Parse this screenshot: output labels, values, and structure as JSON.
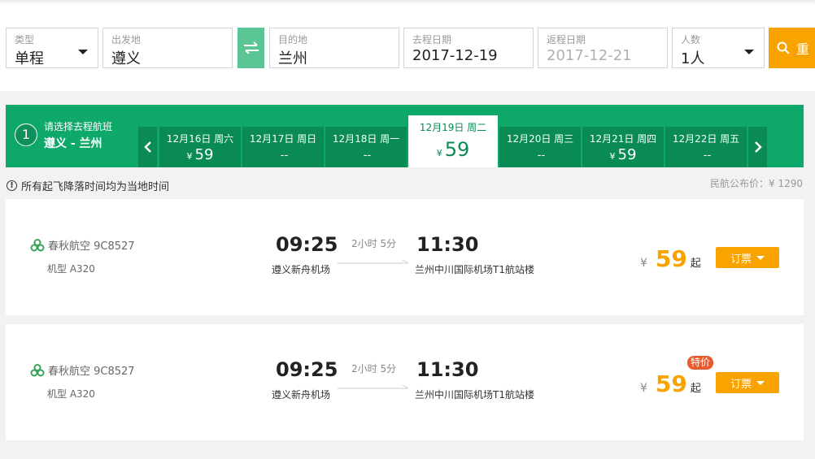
{
  "search": {
    "trip_type": {
      "label": "类型",
      "value": "单程"
    },
    "origin": {
      "label": "出发地",
      "value": "遵义"
    },
    "destination": {
      "label": "目的地",
      "value": "兰州"
    },
    "depart_date": {
      "label": "去程日期",
      "value": "2017-12-19"
    },
    "return_date": {
      "label": "返程日期",
      "value": "2017-12-21"
    },
    "passengers": {
      "label": "人数",
      "value": "1人"
    },
    "search_label": "重"
  },
  "strip": {
    "step": "1",
    "title": "请选择去程航班",
    "route": "遵义 - 兰州",
    "days": [
      {
        "date": "12月16日 周六",
        "price": "59",
        "yen": "¥"
      },
      {
        "date": "12月17日 周日",
        "price": "--",
        "yen": ""
      },
      {
        "date": "12月18日 周一",
        "price": "--",
        "yen": ""
      },
      {
        "date": "12月19日 周二",
        "price": "59",
        "yen": "¥"
      },
      {
        "date": "12月20日 周三",
        "price": "--",
        "yen": ""
      },
      {
        "date": "12月21日 周四",
        "price": "59",
        "yen": "¥"
      },
      {
        "date": "12月22日 周五",
        "price": "--",
        "yen": ""
      }
    ]
  },
  "notice": "所有起飞降落时间均为当地时间",
  "published_price": "民航公布价：¥ 1290",
  "flights": [
    {
      "airline": "春秋航空 9C8527",
      "model": "机型 A320",
      "dep_time": "09:25",
      "dep_airport": "遵义新舟机场",
      "duration": "2小时 5分",
      "arr_time": "11:30",
      "arr_airport": "兰州中川国际机场T1航站楼",
      "yen": "¥",
      "price": "59",
      "price_suffix": "起",
      "book_label": "订票",
      "special": ""
    },
    {
      "airline": "春秋航空 9C8527",
      "model": "机型 A320",
      "dep_time": "09:25",
      "dep_airport": "遵义新舟机场",
      "duration": "2小时 5分",
      "arr_time": "11:30",
      "arr_airport": "兰州中川国际机场T1航站楼",
      "yen": "¥",
      "price": "59",
      "price_suffix": "起",
      "book_label": "订票",
      "special": "特价"
    }
  ],
  "colors": {
    "brand_green": "#0fa86b",
    "accent_orange": "#f8a300",
    "special_red": "#e85a2e"
  }
}
